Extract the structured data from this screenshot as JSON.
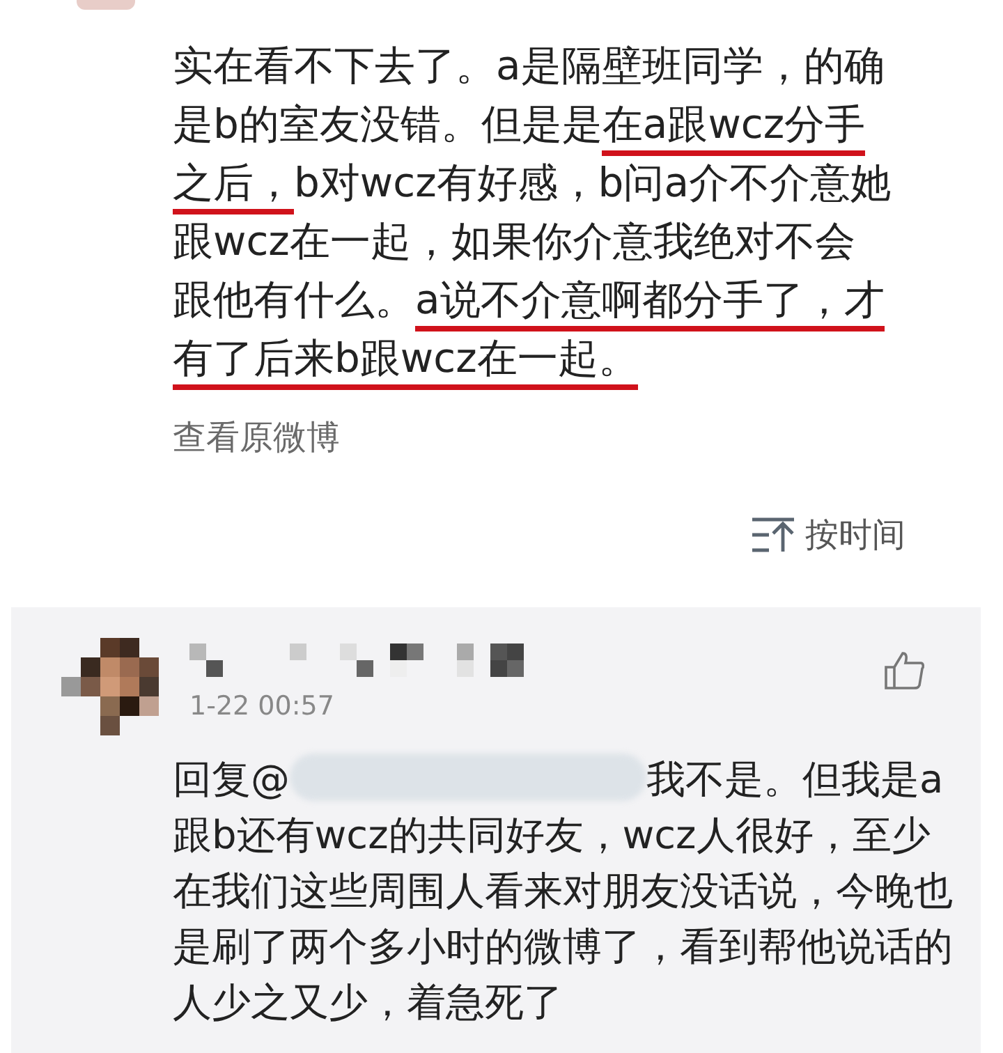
{
  "post": {
    "lines": [
      {
        "segments": [
          {
            "text": "实在看不下去了。a是隔壁班同学，的确",
            "underlined": false
          }
        ]
      },
      {
        "segments": [
          {
            "text": "是b的室友没错。但是是",
            "underlined": false
          },
          {
            "text": "在a跟wcz分手",
            "underlined": true
          }
        ]
      },
      {
        "segments": [
          {
            "text": "之后，",
            "underlined": true
          },
          {
            "text": "b对wcz有好感，b问a介不介意她",
            "underlined": false
          }
        ]
      },
      {
        "segments": [
          {
            "text": "跟wcz在一起，如果你介意我绝对不会",
            "underlined": false
          }
        ]
      },
      {
        "segments": [
          {
            "text": "跟他有什么。",
            "underlined": false
          },
          {
            "text": "a说不介意啊都分手了，才",
            "underlined": true
          }
        ]
      },
      {
        "segments": [
          {
            "text": "有了后来b跟wcz在一起。",
            "underlined": true
          }
        ]
      }
    ],
    "link": "查看原微博"
  },
  "sort": {
    "label": "按时间"
  },
  "comment": {
    "time": "1-22 00:57",
    "reply_prefix": "回复@",
    "reply_lines": [
      "我不是。但我是a",
      "跟b还有wcz的共同好友，wcz人很好，至少",
      "在我们这些周围人看来对朋友没话说，今晚也",
      "是刷了两个多小时的微博了，看到帮他说话的",
      "人少之又少，着急死了"
    ]
  }
}
